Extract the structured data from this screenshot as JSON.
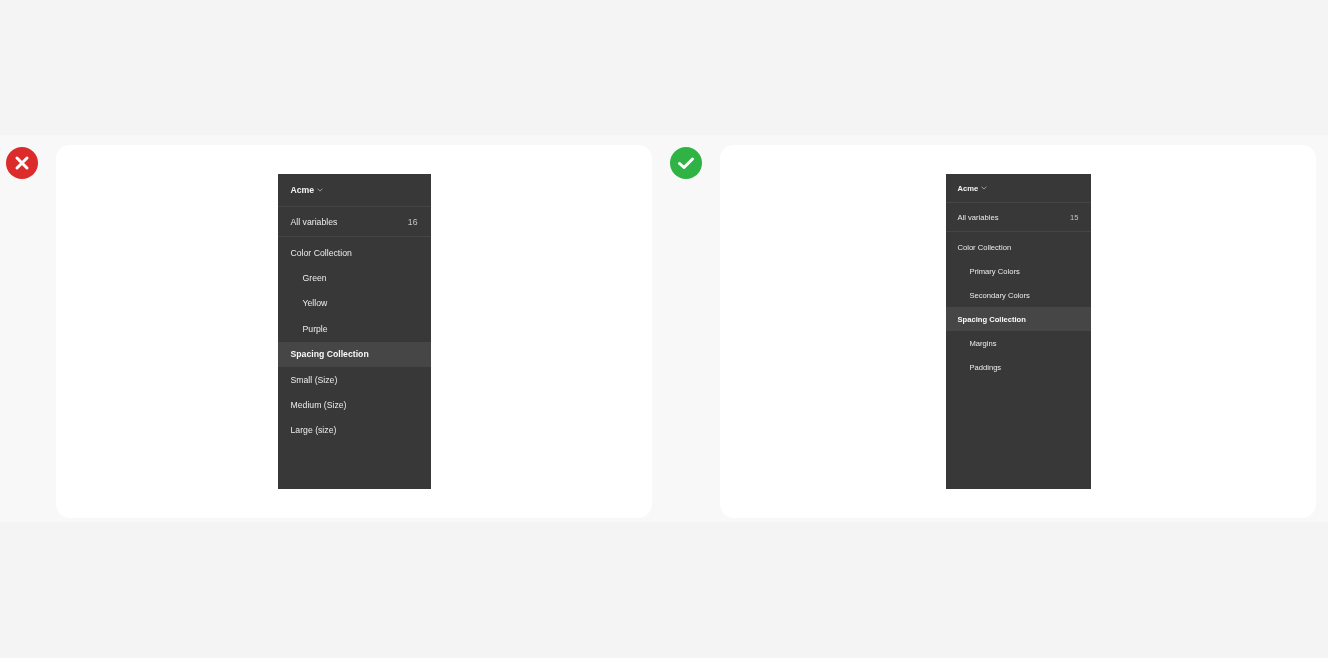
{
  "examples": [
    {
      "kind": "wrong",
      "panel": {
        "title": "Acme",
        "all_variables": {
          "label": "All variables",
          "count": "16",
          "selected": false
        },
        "items": [
          {
            "label": "Color Collection",
            "selected": false,
            "children": [
              {
                "label": "Green",
                "selected": false
              },
              {
                "label": "Yellow",
                "selected": false
              },
              {
                "label": "Purple",
                "selected": false
              }
            ]
          },
          {
            "label": "Spacing Collection",
            "selected": true
          },
          {
            "label": "Small (Size)",
            "selected": false
          },
          {
            "label": "Medium (Size)",
            "selected": false
          },
          {
            "label": "Large (size)",
            "selected": false
          }
        ]
      }
    },
    {
      "kind": "correct",
      "panel": {
        "title": "Acme",
        "all_variables": {
          "label": "All variables",
          "count": "15",
          "selected": false
        },
        "items": [
          {
            "label": "Color Collection",
            "selected": false,
            "children": [
              {
                "label": "Primary Colors",
                "selected": false
              },
              {
                "label": "Secondary Colors",
                "selected": false
              }
            ]
          },
          {
            "label": "Spacing Collection",
            "selected": true,
            "children": [
              {
                "label": "Margins",
                "selected": false
              },
              {
                "label": "Paddings",
                "selected": false
              }
            ]
          }
        ]
      }
    }
  ]
}
